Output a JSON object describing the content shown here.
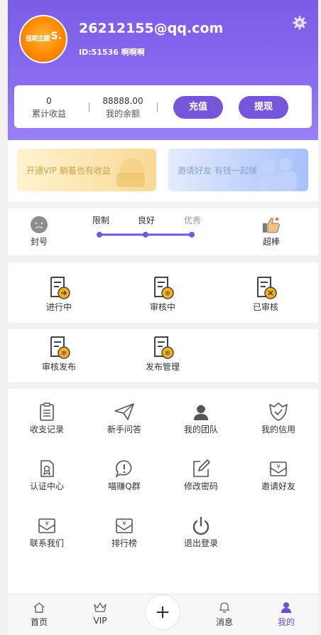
{
  "user": {
    "email": "26212155@qq.com",
    "id_line": "ID:51536 啊啊啊",
    "avatar_text": "佳期主题",
    "avatar_mark": "S."
  },
  "wallet": {
    "earnings_value": "0",
    "earnings_label": "累计收益",
    "balance_value": "88888.00",
    "balance_label": "我的余额",
    "recharge_label": "充值",
    "withdraw_label": "提现"
  },
  "promo": {
    "vip_text": "开通VIP 躺着也有收益",
    "invite_text": "邀请好友 有钱一起赚"
  },
  "level": {
    "left_label": "封号",
    "right_label": "超棒",
    "steps": [
      "限制",
      "良好",
      "优秀"
    ],
    "progress_fraction": 1.0
  },
  "tasks": [
    {
      "label": "进行中",
      "icon": "task-progress-icon"
    },
    {
      "label": "审核中",
      "icon": "task-review-icon"
    },
    {
      "label": "已审核",
      "icon": "task-done-icon"
    }
  ],
  "publish": [
    {
      "label": "审核发布",
      "icon": "review-publish-icon"
    },
    {
      "label": "发布管理",
      "icon": "publish-manage-icon"
    }
  ],
  "menu": [
    {
      "label": "收支记录",
      "icon": "clipboard-icon"
    },
    {
      "label": "新手问答",
      "icon": "paper-plane-icon"
    },
    {
      "label": "我的团队",
      "icon": "team-icon"
    },
    {
      "label": "我的信用",
      "icon": "credit-icon"
    },
    {
      "label": "认证中心",
      "icon": "certify-icon"
    },
    {
      "label": "喵赚Q群",
      "icon": "chat-alert-icon"
    },
    {
      "label": "修改密码",
      "icon": "edit-icon"
    },
    {
      "label": "邀请好友",
      "icon": "invite-envelope-icon"
    },
    {
      "label": "联系我们",
      "icon": "contact-envelope-icon"
    },
    {
      "label": "排行榜",
      "icon": "ranking-envelope-icon"
    },
    {
      "label": "退出登录",
      "icon": "power-icon"
    }
  ],
  "tabbar": [
    {
      "label": "首页",
      "icon": "home-icon"
    },
    {
      "label": "VIP",
      "icon": "crown-icon"
    },
    {
      "label": "+",
      "icon": "plus-icon"
    },
    {
      "label": "消息",
      "icon": "bell-icon"
    },
    {
      "label": "我的",
      "icon": "user-icon"
    }
  ],
  "colors": {
    "primary": "#7356d9",
    "header": "#7b5de6",
    "vip_card": "#f7d996",
    "invite_card": "#a7c1fb",
    "badge": "#f2b01e"
  }
}
